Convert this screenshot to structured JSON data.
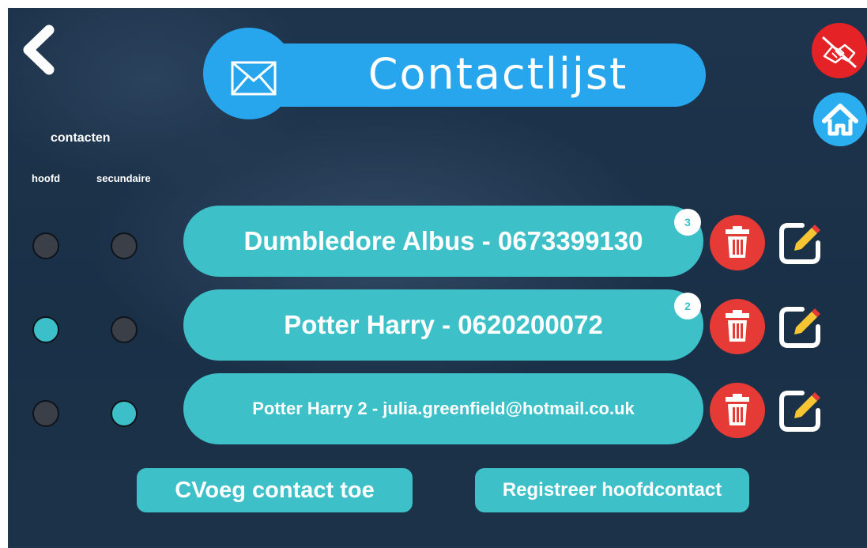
{
  "header": {
    "title": "Contactlijst",
    "icons": {
      "back": "chevron-left-icon",
      "mail": "envelope-icon",
      "no_handshake": "no-handshake-icon",
      "home": "home-icon"
    }
  },
  "columns": {
    "group_label": "contacten",
    "primary_label": "hoofd",
    "secondary_label": "secundaire"
  },
  "contacts": [
    {
      "text": "Dumbledore Albus - 0673399130",
      "badge": "3",
      "primary": false,
      "secondary": false
    },
    {
      "text": "Potter Harry - 0620200072",
      "badge": "2",
      "primary": true,
      "secondary": false
    },
    {
      "text": "Potter Harry 2 - julia.greenfield@hotmail.co.uk",
      "badge": "",
      "primary": false,
      "secondary": true
    }
  ],
  "actions": {
    "add_contact": "CVoeg contact toe",
    "register_primary": "Registreer hoofdcontact"
  },
  "colors": {
    "accent_blue": "#27a6ee",
    "teal": "#3dc0c8",
    "red": "#e53a35",
    "background": "#1c3249"
  }
}
